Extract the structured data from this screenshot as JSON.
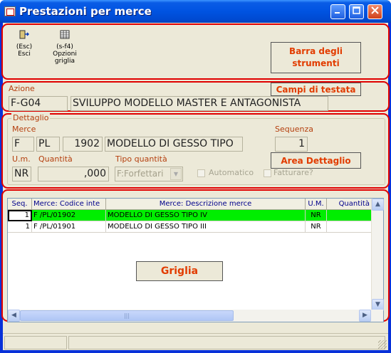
{
  "window": {
    "title": "Prestazioni per merce"
  },
  "toolbar": {
    "exit_key": "(Esc)",
    "exit_label": "Esci",
    "grid_key": "(s-f4)",
    "grid_label1": "Opzioni",
    "grid_label2": "griglia",
    "callout_line1": "Barra degli",
    "callout_line2": "strumenti"
  },
  "header": {
    "caption": "Azione",
    "callout": "Campi di testata",
    "code": "F-G04",
    "description": "SVILUPPO MODELLO MASTER E ANTAGONISTA"
  },
  "detail": {
    "group_title": "Dettaglio",
    "merce_caption": "Merce",
    "merce_f": "F",
    "merce_pl": "PL",
    "merce_num": "1902",
    "merce_desc": "MODELLO DI GESSO TIPO",
    "sequenza_caption": "Sequenza",
    "sequenza_value": "1",
    "um_caption": "U.m.",
    "um_value": "NR",
    "quantita_caption": "Quantità",
    "quantita_value": ",000",
    "tipo_caption": "Tipo quantità",
    "tipo_value": "F:Forfettari",
    "automatico_label": "Automatico",
    "fatturare_label": "Fatturare?",
    "callout": "Area Dettaglio"
  },
  "grid": {
    "columns": [
      "Seq.",
      "Merce: Codice inte",
      "Merce: Descrizione merce",
      "U.M.",
      "Quantità"
    ],
    "rows": [
      {
        "seq": "1",
        "code": "F /PL/01902",
        "desc": "MODELLO DI GESSO TIPO IV",
        "um": "NR",
        "qty": ""
      },
      {
        "seq": "1",
        "code": "F /PL/01901",
        "desc": "MODELLO DI GESSO TIPO III",
        "um": "NR",
        "qty": ""
      }
    ],
    "callout": "Griglia"
  },
  "colors": {
    "selected_row": "#00ee00",
    "callout_text": "#e23c00",
    "annotation_red": "#e00000"
  }
}
